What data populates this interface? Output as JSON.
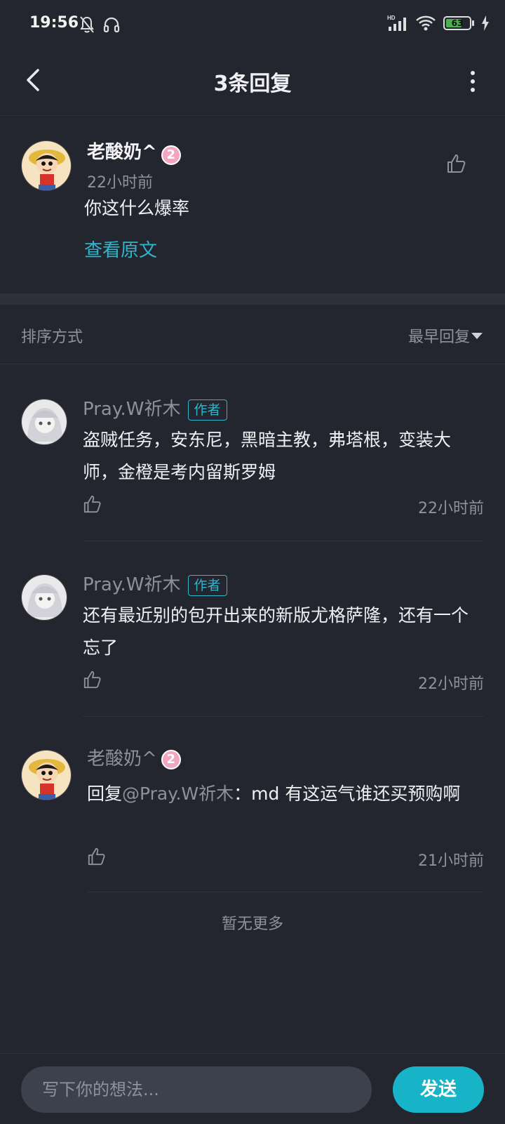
{
  "status_bar": {
    "time": "19:56",
    "battery": "63",
    "icons": [
      "mute-bell-icon",
      "headset-icon",
      "hd-signal-icon",
      "wifi-icon",
      "battery-icon",
      "charging-icon"
    ]
  },
  "header": {
    "title": "3条回复"
  },
  "main_comment": {
    "username": "老酸奶^",
    "level": "2",
    "time": "22小时前",
    "content": "你这什么爆率",
    "view_original": "查看原文"
  },
  "sort": {
    "label": "排序方式",
    "value": "最早回复"
  },
  "replies": [
    {
      "username": "Pray.W祈木",
      "tag": "作者",
      "text": "盗贼任务，安东尼，黑暗主教，弗塔根，变装大师，金橙是考内留斯罗姆",
      "time": "22小时前"
    },
    {
      "username": "Pray.W祈木",
      "tag": "作者",
      "text": "还有最近别的包开出来的新版尤格萨隆，还有一个忘了",
      "time": "22小时前"
    },
    {
      "username": "老酸奶^",
      "level": "2",
      "reply_prefix": "回复",
      "mention": "@Pray.W祈木",
      "text": "：md  有这运气谁还买预购啊",
      "time": "21小时前"
    }
  ],
  "no_more": "暂无更多",
  "input": {
    "placeholder": "写下你的想法..."
  },
  "send_label": "发送",
  "colors": {
    "background": "#23252f",
    "accent": "#30b6cc",
    "send_button": "#17b4c8",
    "level_badge": "#f3a6c0"
  }
}
